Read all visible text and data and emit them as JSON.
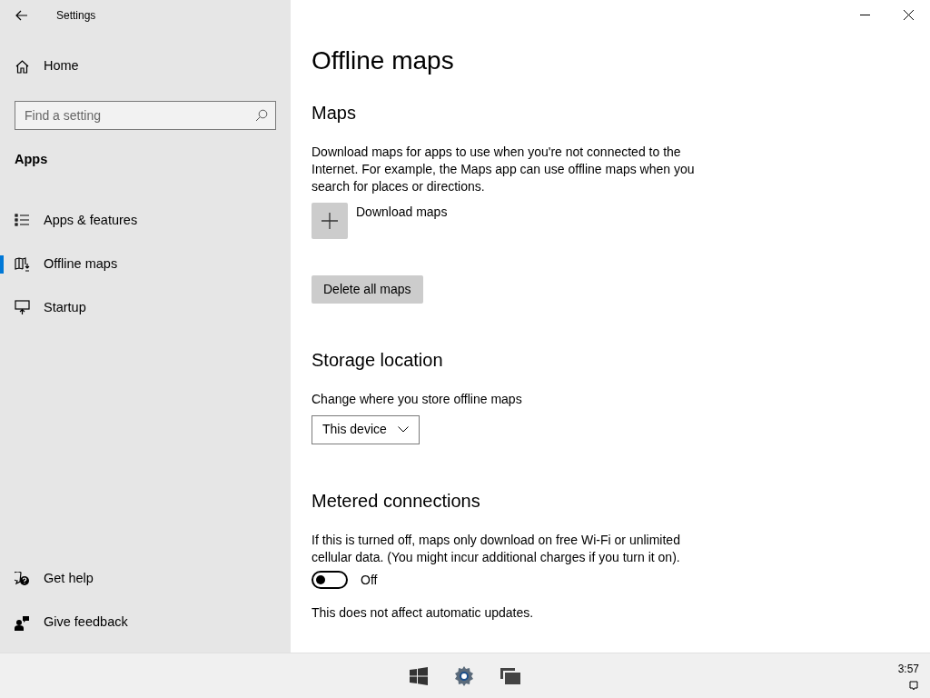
{
  "window": {
    "title": "Settings"
  },
  "sidebar": {
    "home": "Home",
    "search": {
      "placeholder": "Find a setting"
    },
    "section": "Apps",
    "items": [
      {
        "label": "Apps & features",
        "selected": false
      },
      {
        "label": "Offline maps",
        "selected": true
      },
      {
        "label": "Startup",
        "selected": false
      }
    ],
    "footer": [
      "Get help",
      "Give feedback"
    ]
  },
  "page": {
    "title": "Offline maps",
    "maps": {
      "heading": "Maps",
      "description": "Download maps for apps to use when you're not connected to the Internet. For example, the Maps app can use offline maps when you search for places or directions.",
      "download": "Download maps",
      "delete": "Delete all maps"
    },
    "storage": {
      "heading": "Storage location",
      "label": "Change where you store offline maps",
      "value": "This device"
    },
    "metered": {
      "heading": "Metered connections",
      "description": "If this is turned off, maps only download on free Wi-Fi or unlimited cellular data. (You might incur additional charges if you turn it on).",
      "toggle": {
        "on": false,
        "label": "Off"
      },
      "note": "This does not affect automatic updates."
    }
  },
  "taskbar": {
    "time": "3:57"
  }
}
